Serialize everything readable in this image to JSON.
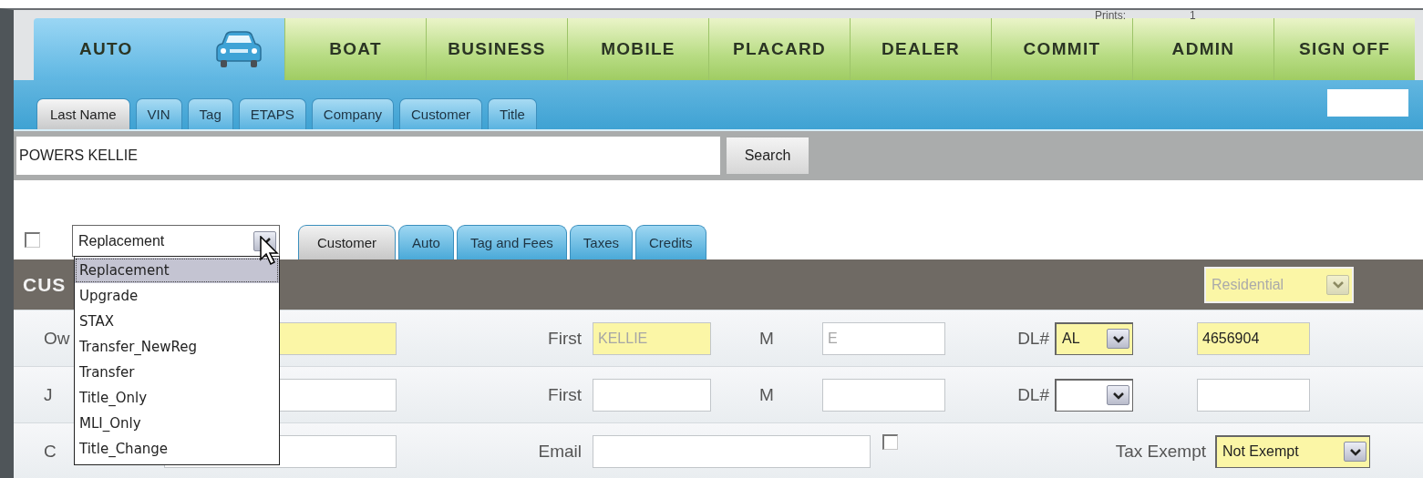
{
  "status": {
    "prints_label": "Prints:",
    "prints_count": "1"
  },
  "main_tabs": [
    {
      "label": "AUTO",
      "selected": true
    },
    {
      "label": "BOAT",
      "selected": false
    },
    {
      "label": "BUSINESS",
      "selected": false
    },
    {
      "label": "MOBILE",
      "selected": false
    },
    {
      "label": "PLACARD",
      "selected": false
    },
    {
      "label": "DEALER",
      "selected": false
    },
    {
      "label": "COMMIT",
      "selected": false
    },
    {
      "label": "ADMIN",
      "selected": false
    },
    {
      "label": "SIGN OFF",
      "selected": false
    }
  ],
  "search_tabs": [
    {
      "label": "Last Name",
      "selected": true
    },
    {
      "label": "VIN",
      "selected": false
    },
    {
      "label": "Tag",
      "selected": false
    },
    {
      "label": "ETAPS",
      "selected": false
    },
    {
      "label": "Company",
      "selected": false
    },
    {
      "label": "Customer",
      "selected": false
    },
    {
      "label": "Title",
      "selected": false
    }
  ],
  "search": {
    "value": "POWERS KELLIE",
    "button": "Search"
  },
  "transaction": {
    "checked": false,
    "value": "Replacement",
    "expanded": true,
    "options": [
      {
        "label": "Replacement",
        "selected": true
      },
      {
        "label": "Upgrade",
        "selected": false
      },
      {
        "label": "STAX",
        "selected": false
      },
      {
        "label": "Transfer_NewReg",
        "selected": false
      },
      {
        "label": "Transfer",
        "selected": false
      },
      {
        "label": "Title_Only",
        "selected": false
      },
      {
        "label": "MLI_Only",
        "selected": false
      },
      {
        "label": "Title_Change",
        "selected": false
      }
    ]
  },
  "form_tabs": [
    {
      "label": "Customer",
      "selected": true
    },
    {
      "label": "Auto",
      "selected": false
    },
    {
      "label": "Tag and Fees",
      "selected": false
    },
    {
      "label": "Taxes",
      "selected": false
    },
    {
      "label": "Credits",
      "selected": false
    }
  ],
  "section": {
    "title": "CUS",
    "residence": {
      "value": "Residential",
      "disabled": true,
      "highlighted": true
    }
  },
  "rows": [
    {
      "items": [
        {
          "kind": "label",
          "text": "Ow"
        },
        {
          "kind": "input",
          "highlighted": true
        },
        {
          "kind": "label",
          "text": "First"
        },
        {
          "kind": "input",
          "value": "KELLIE",
          "highlighted": true,
          "disabled": true
        },
        {
          "kind": "label",
          "text": "M"
        },
        {
          "kind": "input",
          "value": "E",
          "highlighted": false,
          "disabled": true
        },
        {
          "kind": "label",
          "text": "DL#"
        },
        {
          "kind": "select",
          "value": "AL",
          "highlighted": true
        },
        {
          "kind": "input",
          "value": "4656904",
          "highlighted": true,
          "disabled": false
        }
      ]
    },
    {
      "items": [
        {
          "kind": "label",
          "text": "J"
        },
        {
          "kind": "input",
          "highlighted": false
        },
        {
          "kind": "label",
          "text": "First"
        },
        {
          "kind": "input",
          "highlighted": false
        },
        {
          "kind": "label",
          "text": "M"
        },
        {
          "kind": "input",
          "highlighted": false
        },
        {
          "kind": "label",
          "text": "DL#"
        },
        {
          "kind": "select",
          "highlighted": false
        },
        {
          "kind": "input",
          "highlighted": false
        }
      ]
    },
    {
      "items": [
        {
          "kind": "label",
          "text": "C"
        },
        {
          "kind": "input",
          "highlighted": false
        },
        {
          "kind": "label",
          "text": "Email"
        },
        {
          "kind": "input",
          "highlighted": false
        },
        {
          "kind": "checkbox",
          "checked": false
        },
        {
          "kind": "label",
          "text": "Tax Exempt"
        },
        {
          "kind": "select",
          "value": "Not Exempt",
          "highlighted": true
        }
      ]
    }
  ]
}
